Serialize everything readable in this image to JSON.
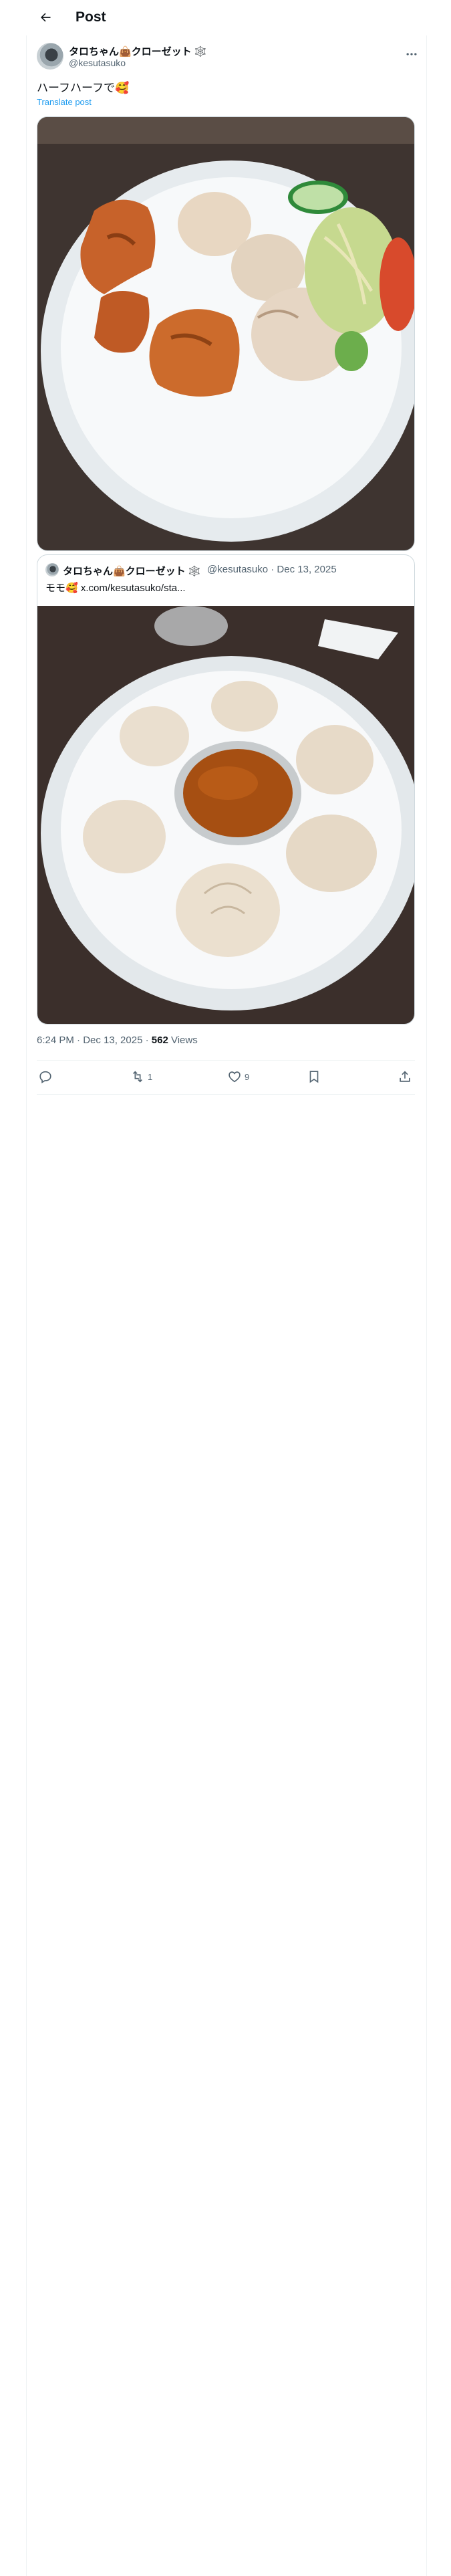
{
  "header": {
    "title": "Post"
  },
  "post": {
    "display_name": "タロちゃん👜クローゼット 🕸️",
    "username": "@kesutasuko",
    "text": "ハーフハーフで🥰",
    "translate_label": "Translate post",
    "time": "6:24 PM · Dec 13, 2025 · ",
    "views_count": "562",
    "views_label": " Views",
    "retweets": "1",
    "likes": "9"
  },
  "quote": {
    "display_name": "タロちゃん👜クローゼット 🕸️",
    "meta": "@kesutasuko · Dec 13, 2025",
    "text": "モモ🥰 x.com/kesutasuko/sta..."
  },
  "icons": [
    "back-arrow-icon",
    "more-icon",
    "reply-icon",
    "retweet-icon",
    "like-icon",
    "bookmark-icon",
    "share-icon"
  ],
  "colors": {
    "link": "#1d9bf0",
    "muted": "#536471",
    "text": "#0f1419",
    "border": "#cfd9de"
  }
}
